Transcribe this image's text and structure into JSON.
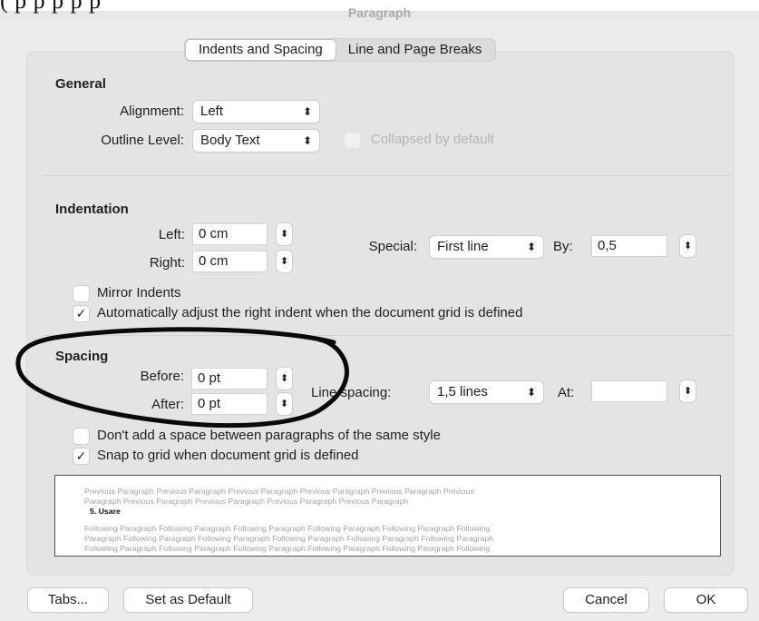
{
  "dialog": {
    "title": "Paragraph",
    "top_fragment": "( p                                                                                    p   p   p   p"
  },
  "tabs": [
    {
      "label": "Indents and Spacing",
      "active": true
    },
    {
      "label": "Line and Page Breaks",
      "active": false
    }
  ],
  "general": {
    "title": "General",
    "alignment_label": "Alignment:",
    "alignment_value": "Left",
    "outline_label": "Outline Level:",
    "outline_value": "Body Text",
    "collapsed_label": "Collapsed by default"
  },
  "indentation": {
    "title": "Indentation",
    "left_label": "Left:",
    "left_value": "0 cm",
    "right_label": "Right:",
    "right_value": "0 cm",
    "special_label": "Special:",
    "special_value": "First line",
    "by_label": "By:",
    "by_value": "0,5",
    "mirror_label": "Mirror Indents",
    "mirror_checked": false,
    "auto_adjust_label": "Automatically adjust the right indent when the document grid is defined",
    "auto_adjust_checked": true
  },
  "spacing": {
    "title": "Spacing",
    "before_label": "Before:",
    "before_value": "0 pt",
    "after_label": "After:",
    "after_value": "0 pt",
    "line_spacing_label": "Line spacing:",
    "line_spacing_value": "1,5 lines",
    "at_label": "At:",
    "at_value": "",
    "dont_add_label": "Don't add a space between paragraphs of the same style",
    "dont_add_checked": false,
    "snap_label": "Snap to grid when document grid is defined",
    "snap_checked": true
  },
  "preview": {
    "previous_lines": [
      "Previous Paragraph Previous Paragraph Previous Paragraph Previous Paragraph Previous Paragraph Previous",
      "Paragraph Previous Paragraph Previous Paragraph Previous Paragraph Previous Paragraph"
    ],
    "current": "5. Usare",
    "following_lines": [
      "Following Paragraph Following Paragraph Following Paragraph Following Paragraph Following Paragraph Following",
      "Paragraph Following Paragraph Following Paragraph Following Paragraph Following Paragraph Following Paragraph",
      "Following Paragraph Following Paragraph Following Paragraph Following Paragraph Following Paragraph Following"
    ]
  },
  "buttons": {
    "tabs": "Tabs...",
    "set_default": "Set as Default",
    "cancel": "Cancel",
    "ok": "OK"
  },
  "icons": {
    "checkmark": "✓",
    "chevron": "updown-chevron-icon",
    "stepper": "stepper-arrows-icon"
  },
  "colors": {
    "annotation_ink": "#0a0a0a",
    "panel_bg": "#e4e4e4",
    "window_bg": "#ececec"
  }
}
